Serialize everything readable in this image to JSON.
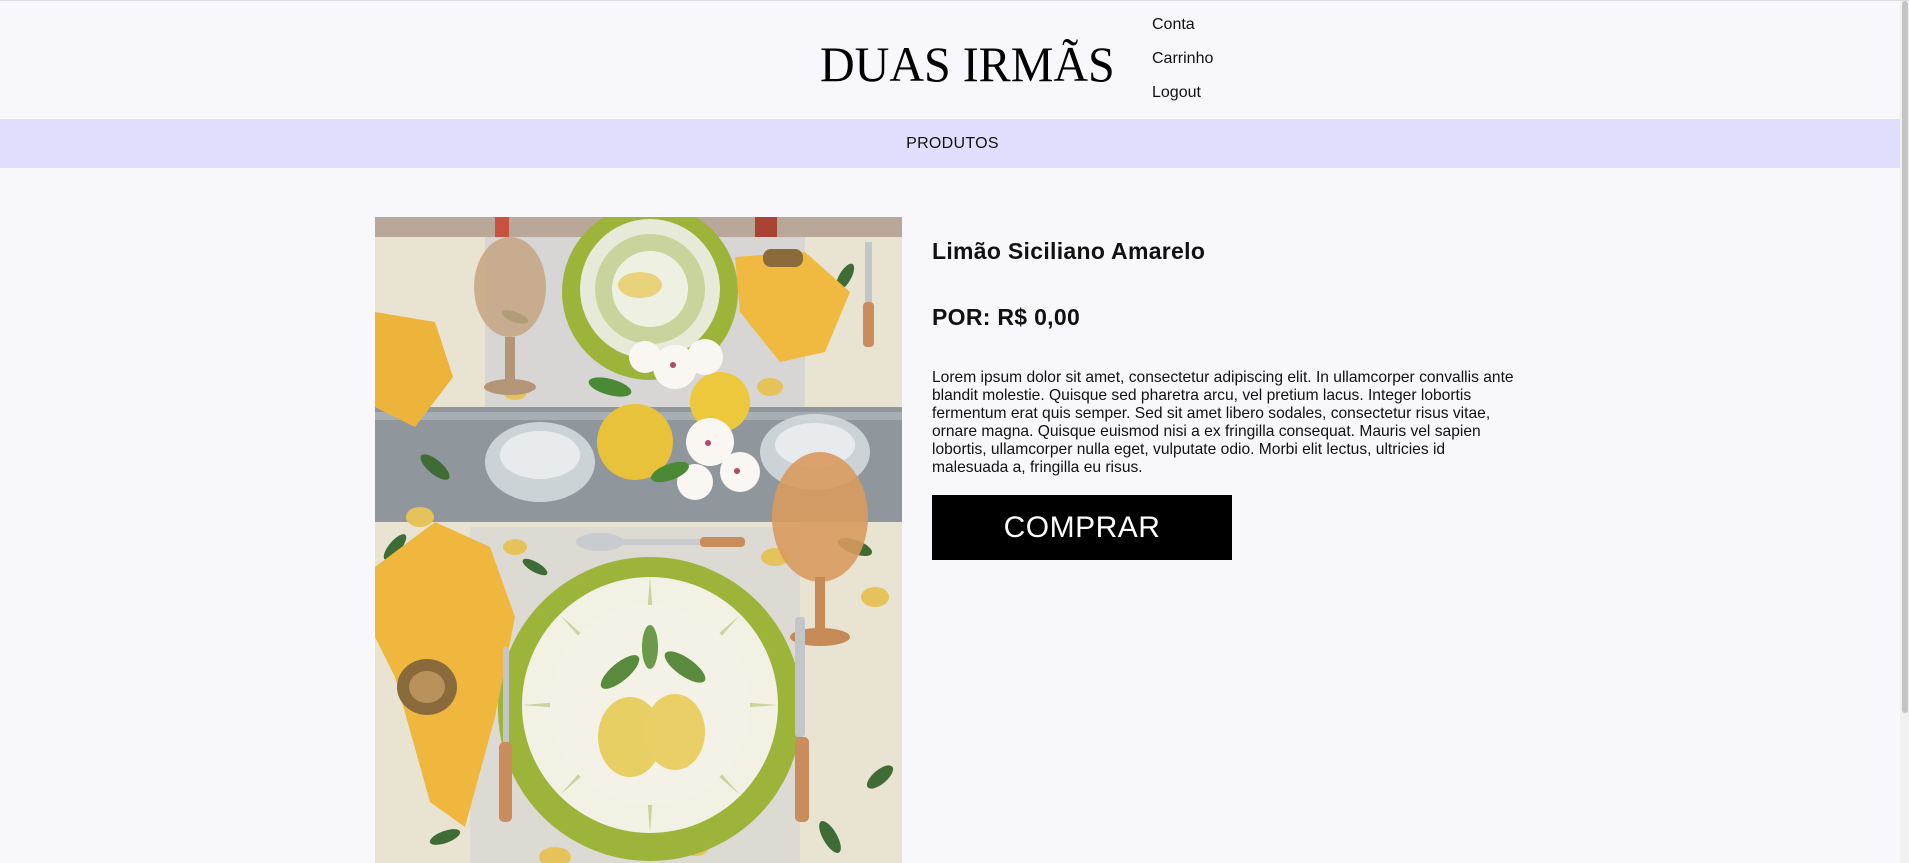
{
  "header": {
    "logo": "DUAS IRMÃS",
    "user_menu": [
      "Conta",
      "Carrinho",
      "Logout"
    ]
  },
  "nav": {
    "items": [
      "PRODUTOS"
    ]
  },
  "product": {
    "name": "Limão Siciliano Amarelo",
    "price": "POR: R$ 0,00",
    "description": "Lorem ipsum dolor sit amet, consectetur adipiscing elit. In ullamcorper convallis ante blandit molestie. Quisque sed pharetra arcu, vel pretium lacus. Integer lobortis fermentum erat quis semper. Sed sit amet libero sodales, consectetur risus vitae, ornare magna. Quisque euismod nisi a ex fringilla consequat. Mauris vel sapien lobortis, ullamcorper nulla eget, vulputate odio. Morbi elit lectus, ultricies id malesuada a, fringilla eu risus.",
    "buy_label": "COMPRAR"
  },
  "colors": {
    "background": "#f8f8fc",
    "navbar": "#dfdffd",
    "button": "#000000",
    "button_text": "#ffffff"
  }
}
